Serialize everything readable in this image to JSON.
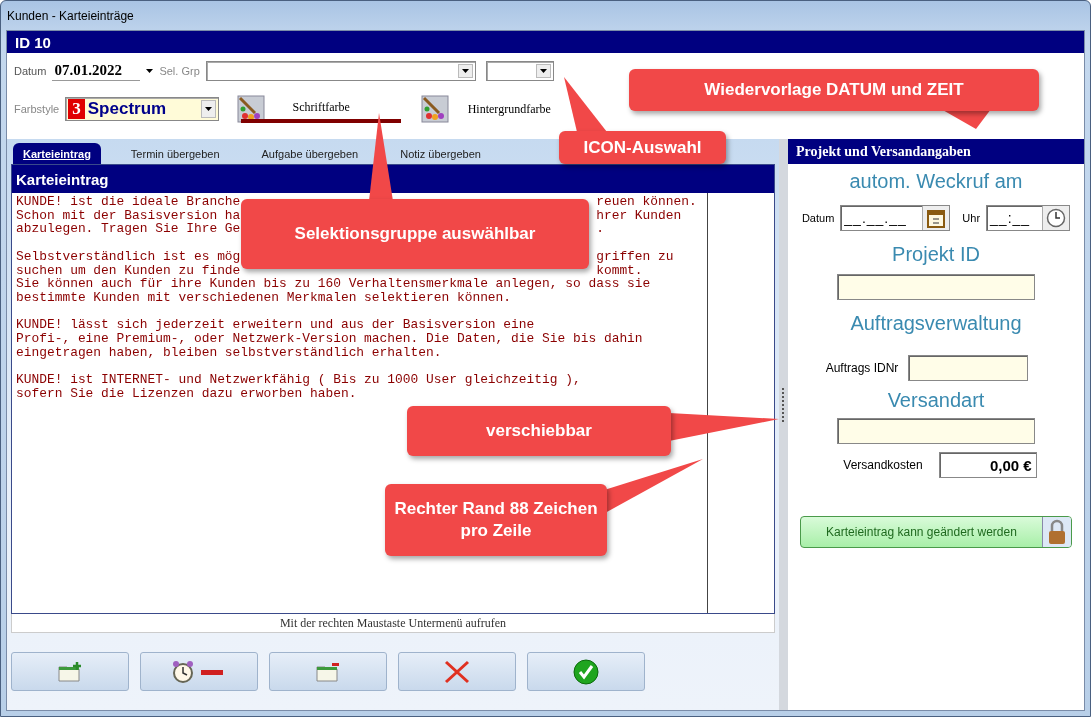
{
  "window": {
    "title": "Kunden - Karteieinträge"
  },
  "header": {
    "title": "ID 10"
  },
  "form": {
    "date_label": "Datum",
    "date_value": "07.01.2022",
    "group_label": "Sel. Grp",
    "style_label": "Farbstyle",
    "style_number": "3",
    "style_name": "Spectrum",
    "font_color_label": "Schriftfarbe",
    "background_color_label": "Hintergrundfarbe"
  },
  "tabs": [
    {
      "label": "Karteieintrag",
      "selected": true
    },
    {
      "label": "Termin übergeben",
      "selected": false
    },
    {
      "label": "Aufgabe übergeben",
      "selected": false
    },
    {
      "label": "Notiz übergeben",
      "selected": false
    }
  ],
  "editor": {
    "title": "Karteieintrag",
    "paragraphs": [
      [
        [
          "KUNDE! ist die ideale Branche",
          "reuen können."
        ],
        [
          "Schon mit der Basisversion ha",
          "hrer Kunden"
        ],
        [
          "abzulegen. Tragen Sie Ihre Ge",
          "."
        ]
      ],
      [
        [
          "Selbstverständlich ist es mög",
          "griffen zu"
        ],
        [
          "suchen um den Kunden zu finde",
          "kommt."
        ],
        [
          "Sie können auch für ihre Kunden bis zu 160 Verhaltensmerkmale anlegen, so dass sie"
        ],
        [
          "bestimmte Kunden mit verschiedenen Merkmalen selektieren können."
        ]
      ],
      [
        [
          "KUNDE! lässt sich jederzeit erweitern und aus der Basisversion eine"
        ],
        [
          "Profi-, eine Premium-, oder Netzwerk-Version machen. Die Daten, die Sie bis dahin"
        ],
        [
          "eingetragen haben, bleiben selbstverständlich erhalten."
        ]
      ],
      [
        [
          "KUNDE! ist INTERNET- und Netzwerkfähig ( Bis zu 1000 User gleichzeitig ),"
        ],
        [
          "sofern Sie die Lizenzen dazu erworben haben."
        ]
      ]
    ],
    "hint": "Mit der rechten Maustaste Untermenü aufrufen"
  },
  "toolbar": [
    {
      "kind": "new-folder"
    },
    {
      "kind": "alarm-remove"
    },
    {
      "kind": "folder-remove"
    },
    {
      "kind": "delete"
    },
    {
      "kind": "confirm"
    }
  ],
  "side_panel": {
    "title": "Projekt und Versandangaben",
    "wakeup_heading": "autom. Weckruf am",
    "date_label": "Datum",
    "date_value": "__.__.__",
    "time_label": "Uhr",
    "time_value": "__:__",
    "project_heading": "Projekt ID",
    "order_heading": "Auftragsverwaltung",
    "order_label": "Auftrags IDNr",
    "shipping_heading": "Versandart",
    "cost_label": "Versandkosten",
    "cost_value": "0,00 €",
    "lock_button": "Karteieintrag kann geändert werden"
  },
  "callouts": [
    {
      "text": "Wiedervorlage DATUM und ZEIT"
    },
    {
      "text": "ICON-Auswahl"
    },
    {
      "text": "Selektionsgruppe auswählbar"
    },
    {
      "text": "verschiebbar"
    },
    {
      "text": "Rechter Rand 88 Zeichen pro Zeile"
    }
  ]
}
